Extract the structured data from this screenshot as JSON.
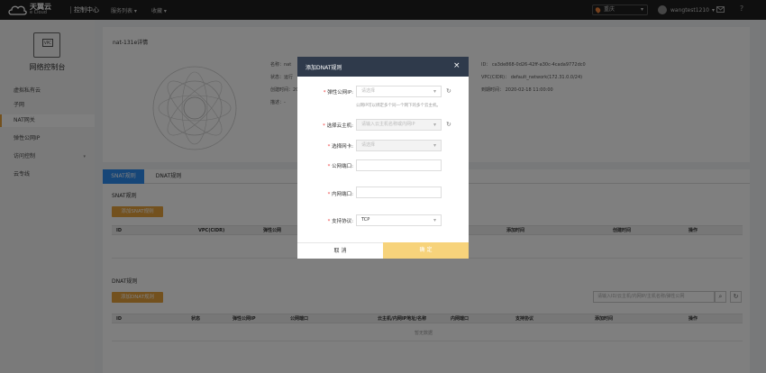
{
  "header": {
    "brand_cn": "天翼云",
    "brand_en": "e Cloud",
    "console_title": "控制中心",
    "menu_services": "服务列表 ▾",
    "menu_favorites": "收藏 ▾",
    "region": "重庆",
    "username": "wangtest1210",
    "user_caret": "▾",
    "icon_mail": "mail-icon",
    "icon_help": "help-icon"
  },
  "sidebar": {
    "logo_text": "VPC",
    "title": "网络控制台",
    "items": [
      {
        "label": "虚拟私有云"
      },
      {
        "label": "子网"
      },
      {
        "label": "NAT网关"
      },
      {
        "label": "弹性公网IP"
      },
      {
        "label": "访问控制"
      },
      {
        "label": "云专线"
      }
    ]
  },
  "detail": {
    "name": "nat-131e详情",
    "label_name": "名称：",
    "name_value_partial": "nat",
    "label_status": "状态：",
    "status_partial": "运行",
    "label_created": "创建时间：",
    "created_partial": "20",
    "label_desc": "描述：",
    "desc_partial": "-",
    "id_label": "ID：",
    "id_value": "ca3de868-0d26-42ff-a30c-4cada9772dc0",
    "vpc_label": "VPC(CIDR)：",
    "vpc_value": "default_network(172.31.0.0/24)",
    "expire_label": "到期时间：",
    "expire_value": "2020-02-18 11:00:00"
  },
  "tabs": [
    {
      "label": "SNAT规则"
    },
    {
      "label": "DNAT规则"
    }
  ],
  "snat": {
    "title": "SNAT规则",
    "add_button": "添加SNAT规则",
    "columns": [
      "ID",
      "VPC(CIDR)",
      "弹性公网",
      "添加时间",
      "创建时间",
      "操作"
    ]
  },
  "dnat": {
    "title": "DNAT规则",
    "add_button": "添加DNAT规则",
    "search_placeholder": "请输入ID/云主机/内网IP/主机名称/弹性公网",
    "columns": [
      "ID",
      "状态",
      "弹性公网IP",
      "公网端口",
      "云主机/内网IP地址/名称",
      "内网端口",
      "支持协议",
      "添加时间",
      "操作"
    ],
    "empty_text": "暂无数据"
  },
  "modal": {
    "title": "添加DNAT规则",
    "close": "×",
    "required_mark": "*",
    "field_eip_label": "弹性公网IP:",
    "field_eip_placeholder": "请选择",
    "field_eip_hint": "公网IP可以绑定多个同一个网下的多个云主机。",
    "field_vm_label": "选择云主机:",
    "field_vm_placeholder": "请输入云主机名称或内网IP",
    "field_nic_label": "选择网卡:",
    "field_nic_placeholder": "请选择",
    "field_public_port_label": "公网端口:",
    "field_private_port_label": "内网端口:",
    "field_protocol_label": "支持协议:",
    "field_protocol_value": "TCP",
    "cancel_button": "取 消",
    "ok_button": "确 定",
    "icon_chevron": "▾",
    "icon_refresh": "↻"
  }
}
